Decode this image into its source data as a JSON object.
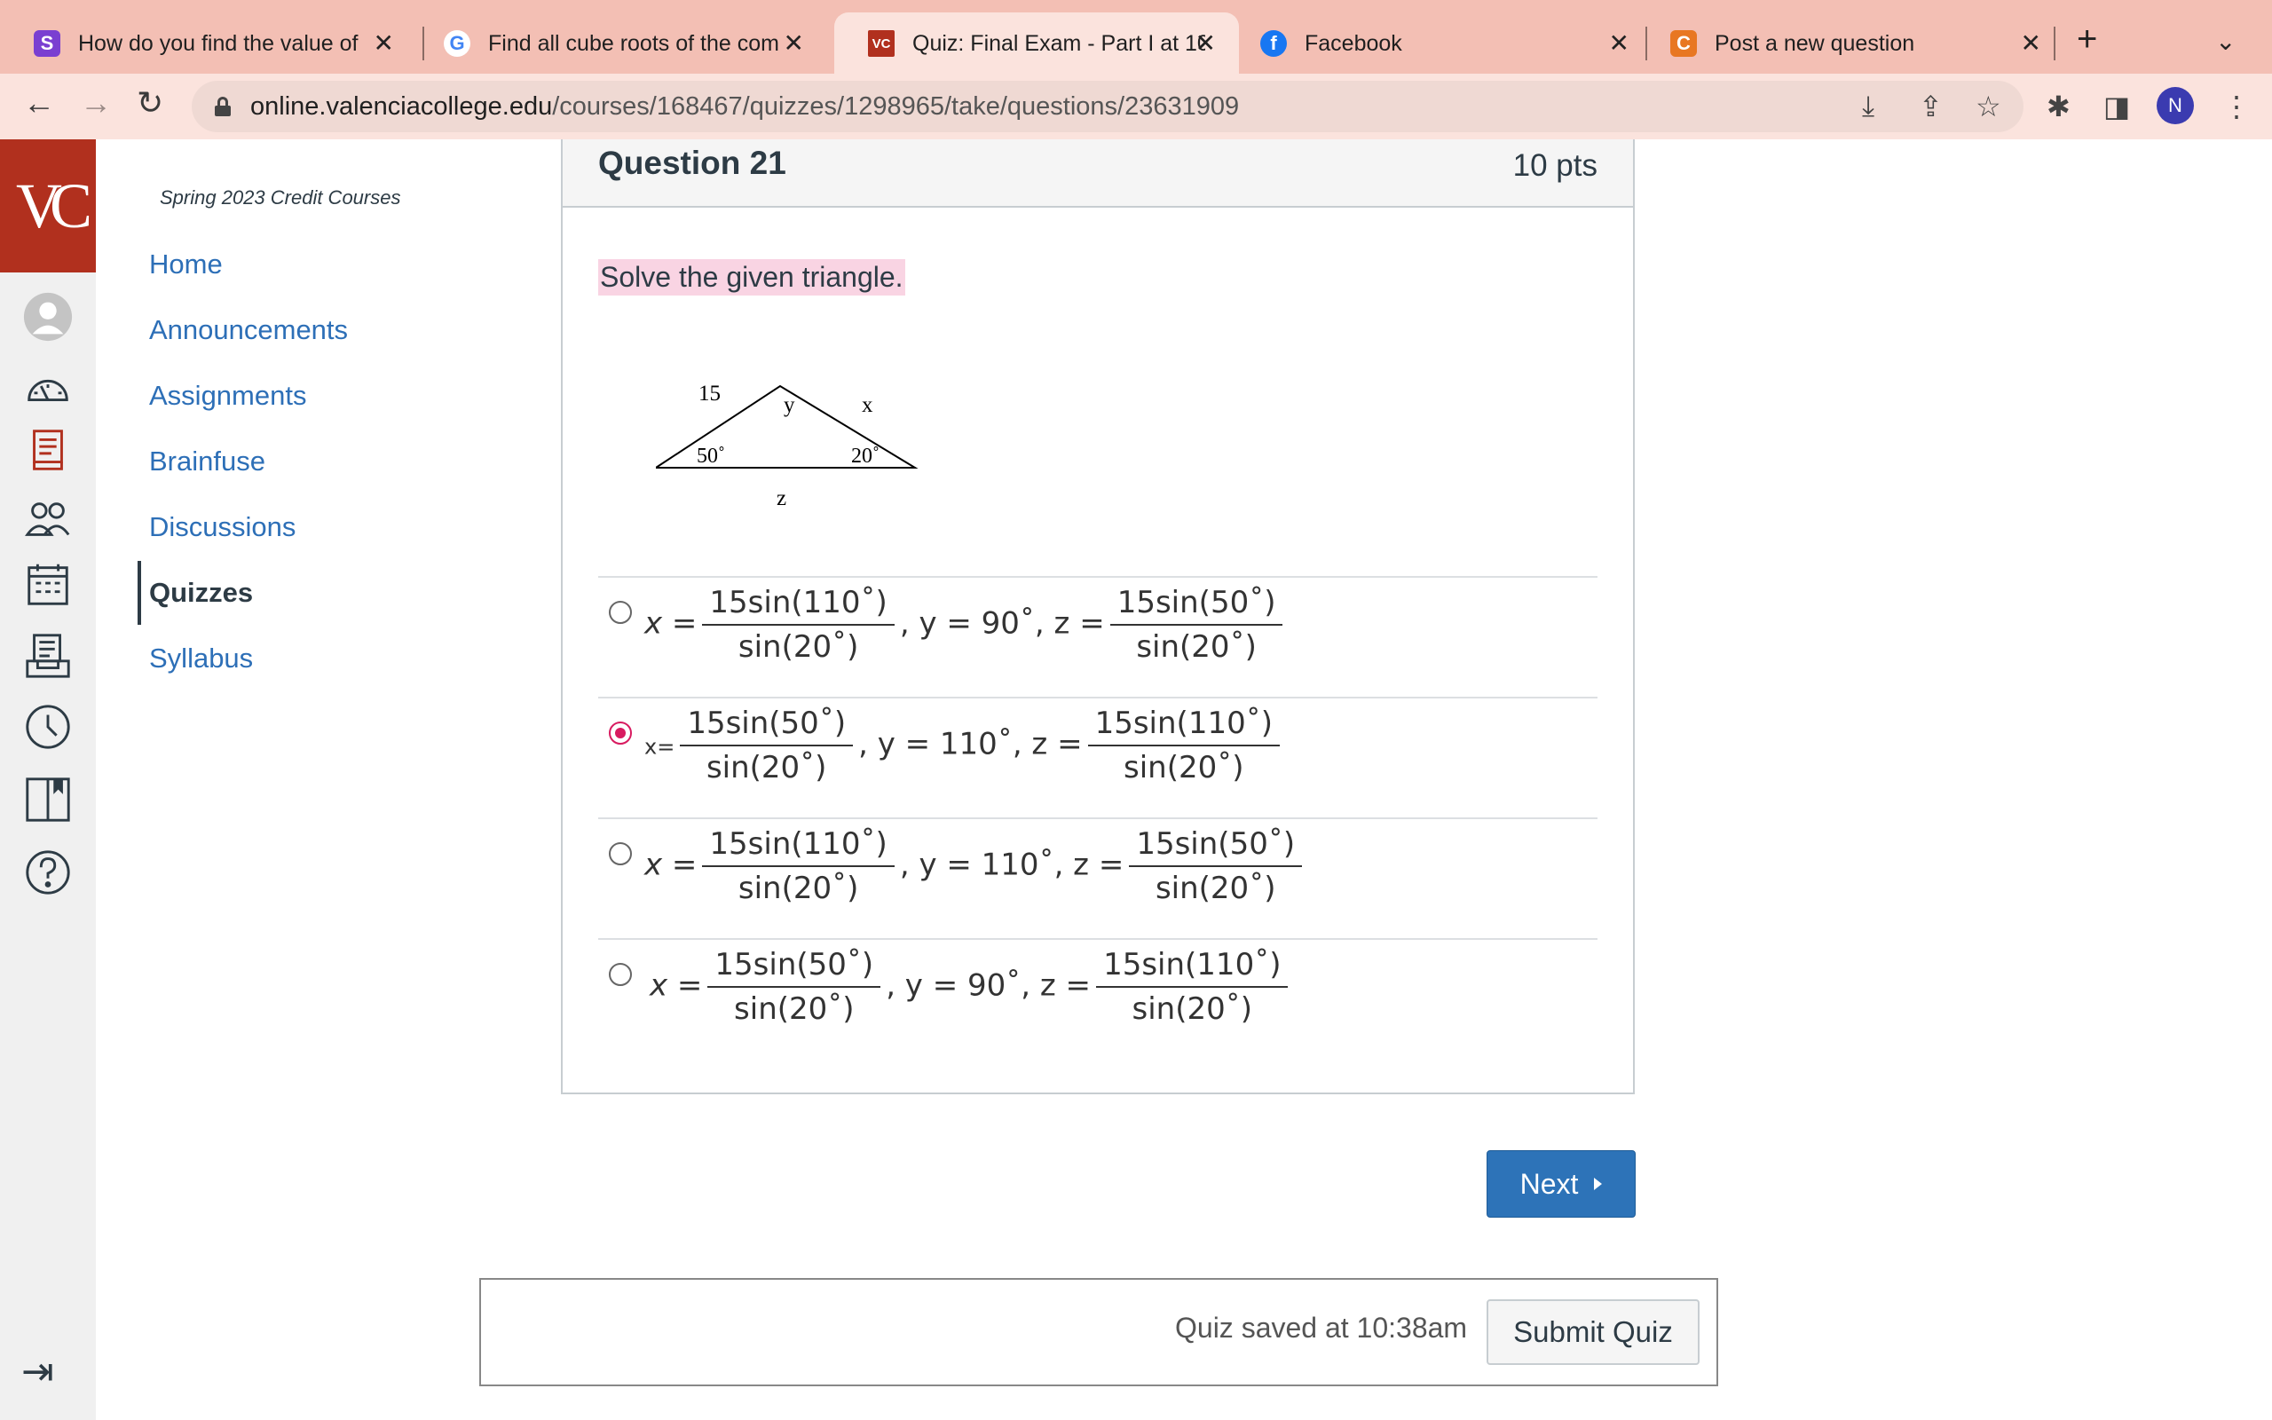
{
  "browser": {
    "tabs": [
      {
        "title": "How do you find the value of",
        "icon": "S"
      },
      {
        "title": "Find all cube roots of the com",
        "icon": "G"
      },
      {
        "title": "Quiz: Final Exam - Part I at 10",
        "icon": "VC"
      },
      {
        "title": "Facebook",
        "icon": "f"
      },
      {
        "title": "Post a new question",
        "icon": "C"
      }
    ],
    "url_host": "online.valenciacollege.edu",
    "url_path": "/courses/168467/quizzes/1298965/take/questions/23631909",
    "profile_initial": "N"
  },
  "logo": "VC",
  "course_nav": {
    "term": "Spring 2023 Credit Courses",
    "items": [
      "Home",
      "Announcements",
      "Assignments",
      "Brainfuse",
      "Discussions",
      "Quizzes",
      "Syllabus"
    ],
    "active": "Quizzes"
  },
  "question": {
    "title": "Question 21",
    "points": "10 pts",
    "text": "Solve the given triangle.",
    "figure": {
      "side_left": "15",
      "angle_top": "y",
      "side_right": "x",
      "angle_left": "50˚",
      "angle_right": "20˚",
      "side_bottom": "z"
    },
    "answers": [
      {
        "x_lbl": "x =",
        "x_num": "15sin(110˚)",
        "x_den": "sin(20˚)",
        "y_part": ", y = 90˚, z =",
        "z_num": "15sin(50˚)",
        "z_den": "sin(20˚)",
        "selected": false
      },
      {
        "x_lbl": "x=",
        "x_num": "15sin(50˚)",
        "x_den": "sin(20˚)",
        "y_part": ", y = 110˚, z =",
        "z_num": "15sin(110˚)",
        "z_den": "sin(20˚)",
        "selected": true
      },
      {
        "x_lbl": "x =",
        "x_num": "15sin(110˚)",
        "x_den": "sin(20˚)",
        "y_part": ", y = 110˚, z =",
        "z_num": "15sin(50˚)",
        "z_den": "sin(20˚)",
        "selected": false
      },
      {
        "x_lbl": "x =",
        "x_num": "15sin(50˚)",
        "x_den": "sin(20˚)",
        "y_part": ", y = 90˚, z =",
        "z_num": "15sin(110˚)",
        "z_den": "sin(20˚)",
        "selected": false
      }
    ]
  },
  "buttons": {
    "next": "Next",
    "submit": "Submit Quiz"
  },
  "status": {
    "saved": "Quiz saved at 10:38am"
  },
  "colors": {
    "brand": "#b1301e",
    "link": "#2d6fb7",
    "primary_button": "#2d73b8",
    "selected_radio": "#d81b60",
    "highlight": "#f9d4e3"
  }
}
